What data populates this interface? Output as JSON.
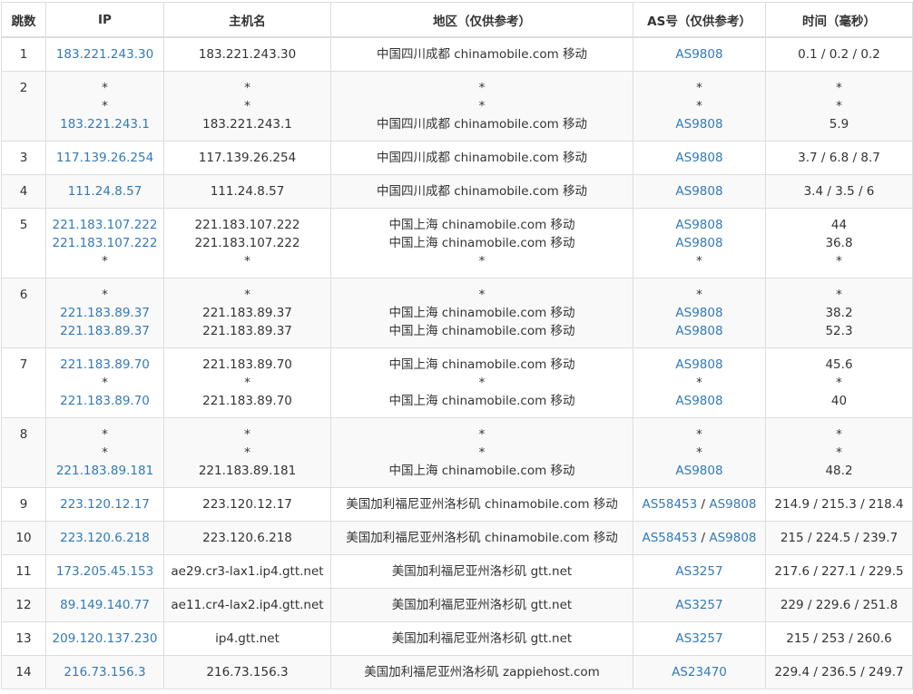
{
  "headers": [
    "跳数",
    "IP",
    "主机名",
    "地区（仅供参考）",
    "AS号（仅供参考）",
    "时间（毫秒）"
  ],
  "rows": [
    {
      "hop": "1",
      "h": 37,
      "lines": [
        {
          "ip": "183.221.243.30",
          "host": "183.221.243.30",
          "region": "中国四川成都 chinamobile.com 移动",
          "as": [
            "AS9808"
          ],
          "time": "0.1 / 0.2 / 0.2"
        }
      ]
    },
    {
      "hop": "2",
      "h": 77,
      "lines": [
        {
          "ip": "*",
          "host": "*",
          "region": "*",
          "as": [
            "*"
          ],
          "time": "*"
        },
        {
          "ip": "*",
          "host": "*",
          "region": "*",
          "as": [
            "*"
          ],
          "time": "*"
        },
        {
          "ip": "183.221.243.1",
          "host": "183.221.243.1",
          "region": "中国四川成都 chinamobile.com 移动",
          "as": [
            "AS9808"
          ],
          "time": "5.9"
        }
      ]
    },
    {
      "hop": "3",
      "h": 37,
      "lines": [
        {
          "ip": "117.139.26.254",
          "host": "117.139.26.254",
          "region": "中国四川成都 chinamobile.com 移动",
          "as": [
            "AS9808"
          ],
          "time": "3.7 / 6.8 / 8.7"
        }
      ]
    },
    {
      "hop": "4",
      "h": 37,
      "lines": [
        {
          "ip": "111.24.8.57",
          "host": "111.24.8.57",
          "region": "中国四川成都 chinamobile.com 移动",
          "as": [
            "AS9808"
          ],
          "time": "3.4 / 3.5 / 6"
        }
      ]
    },
    {
      "hop": "5",
      "h": 77,
      "lines": [
        {
          "ip": "221.183.107.222",
          "host": "221.183.107.222",
          "region": "中国上海 chinamobile.com 移动",
          "as": [
            "AS9808"
          ],
          "time": "44"
        },
        {
          "ip": "221.183.107.222",
          "host": "221.183.107.222",
          "region": "中国上海 chinamobile.com 移动",
          "as": [
            "AS9808"
          ],
          "time": "36.8"
        },
        {
          "ip": "*",
          "host": "*",
          "region": "*",
          "as": [
            "*"
          ],
          "time": "*"
        }
      ]
    },
    {
      "hop": "6",
      "h": 77,
      "lines": [
        {
          "ip": "*",
          "host": "*",
          "region": "*",
          "as": [
            "*"
          ],
          "time": "*"
        },
        {
          "ip": "221.183.89.37",
          "host": "221.183.89.37",
          "region": "中国上海 chinamobile.com 移动",
          "as": [
            "AS9808"
          ],
          "time": "38.2"
        },
        {
          "ip": "221.183.89.37",
          "host": "221.183.89.37",
          "region": "中国上海 chinamobile.com 移动",
          "as": [
            "AS9808"
          ],
          "time": "52.3"
        }
      ]
    },
    {
      "hop": "7",
      "h": 77,
      "lines": [
        {
          "ip": "221.183.89.70",
          "host": "221.183.89.70",
          "region": "中国上海 chinamobile.com 移动",
          "as": [
            "AS9808"
          ],
          "time": "45.6"
        },
        {
          "ip": "*",
          "host": "*",
          "region": "*",
          "as": [
            "*"
          ],
          "time": "*"
        },
        {
          "ip": "221.183.89.70",
          "host": "221.183.89.70",
          "region": "中国上海 chinamobile.com 移动",
          "as": [
            "AS9808"
          ],
          "time": "40"
        }
      ]
    },
    {
      "hop": "8",
      "h": 77,
      "lines": [
        {
          "ip": "*",
          "host": "*",
          "region": "*",
          "as": [
            "*"
          ],
          "time": "*"
        },
        {
          "ip": "*",
          "host": "*",
          "region": "*",
          "as": [
            "*"
          ],
          "time": "*"
        },
        {
          "ip": "221.183.89.181",
          "host": "221.183.89.181",
          "region": "中国上海 chinamobile.com 移动",
          "as": [
            "AS9808"
          ],
          "time": "48.2"
        }
      ]
    },
    {
      "hop": "9",
      "h": 37,
      "lines": [
        {
          "ip": "223.120.12.17",
          "host": "223.120.12.17",
          "region": "美国加利福尼亚州洛杉矶 chinamobile.com 移动",
          "as": [
            "AS58453",
            "AS9808"
          ],
          "time": "214.9 / 215.3 / 218.4"
        }
      ]
    },
    {
      "hop": "10",
      "h": 37,
      "lines": [
        {
          "ip": "223.120.6.218",
          "host": "223.120.6.218",
          "region": "美国加利福尼亚州洛杉矶 chinamobile.com 移动",
          "as": [
            "AS58453",
            "AS9808"
          ],
          "time": "215 / 224.5 / 239.7"
        }
      ]
    },
    {
      "hop": "11",
      "h": 37,
      "lines": [
        {
          "ip": "173.205.45.153",
          "host": "ae29.cr3-lax1.ip4.gtt.net",
          "region": "美国加利福尼亚州洛杉矶 gtt.net",
          "as": [
            "AS3257"
          ],
          "time": "217.6 / 227.1 / 229.5"
        }
      ]
    },
    {
      "hop": "12",
      "h": 37,
      "lines": [
        {
          "ip": "89.149.140.77",
          "host": "ae11.cr4-lax2.ip4.gtt.net",
          "region": "美国加利福尼亚州洛杉矶 gtt.net",
          "as": [
            "AS3257"
          ],
          "time": "229 / 229.6 / 251.8"
        }
      ]
    },
    {
      "hop": "13",
      "h": 37,
      "lines": [
        {
          "ip": "209.120.137.230",
          "host": "ip4.gtt.net",
          "region": "美国加利福尼亚州洛杉矶 gtt.net",
          "as": [
            "AS3257"
          ],
          "time": "215 / 253 / 260.6"
        }
      ]
    },
    {
      "hop": "14",
      "h": 37,
      "lines": [
        {
          "ip": "216.73.156.3",
          "host": "216.73.156.3",
          "region": "美国加利福尼亚州洛杉矶 zappiehost.com",
          "as": [
            "AS23470"
          ],
          "time": "229.4 / 236.5 / 249.7"
        }
      ]
    }
  ],
  "colors": {
    "link": "#337ab7",
    "text": "#333333",
    "border": "#dddddd",
    "stripe": "#f9f9f9"
  }
}
